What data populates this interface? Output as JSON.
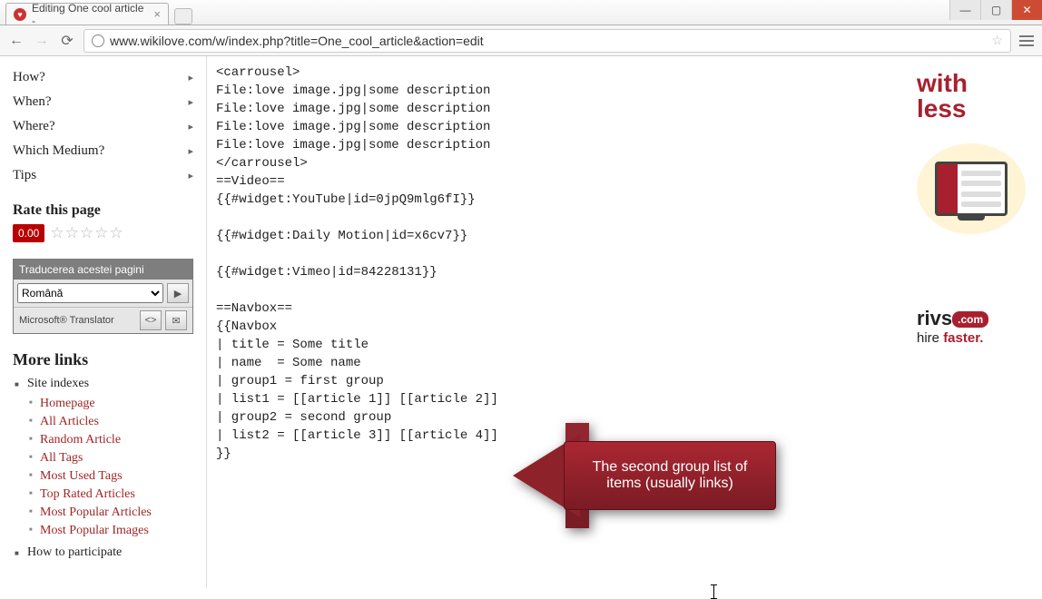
{
  "window": {
    "tab_title": "Editing One cool article - ",
    "url": "www.wikilove.com/w/index.php?title=One_cool_article&action=edit"
  },
  "sidebar": {
    "nav": [
      "How?",
      "When?",
      "Where?",
      "Which Medium?",
      "Tips"
    ],
    "rate_heading": "Rate this page",
    "rate_value": "0.00",
    "translate_heading": "Traducerea acestei pagini",
    "translate_lang": "Română",
    "translate_brand": "Microsoft® Translator",
    "more_heading": "More links",
    "site_indexes_label": "Site indexes",
    "site_indexes": [
      "Homepage",
      "All Articles",
      "Random Article",
      "All Tags",
      "Most Used Tags",
      "Top Rated Articles",
      "Most Popular Articles",
      "Most Popular Images"
    ],
    "how_to_label": "How to participate"
  },
  "editor": {
    "text": "<carrousel>\nFile:love image.jpg|some description\nFile:love image.jpg|some description\nFile:love image.jpg|some description\nFile:love image.jpg|some description\n</carrousel>\n==Video==\n{{#widget:YouTube|id=0jpQ9mlg6fI}}\n\n{{#widget:Daily Motion|id=x6cv7}}\n\n{{#widget:Vimeo|id=84228131}}\n\n==Navbox==\n{{Navbox\n| title = Some title\n| name  = Some name\n| group1 = first group\n| list1 = [[article 1]] [[article 2]]\n| group2 = second group\n| list2 = [[article 3]] [[article 4]]\n}}"
  },
  "callout": {
    "text": "The second group list of items (usually links)"
  },
  "ad": {
    "tagline1": "with",
    "tagline2": "less",
    "brand": "rivs",
    "brand_suffix": ".com",
    "slogan_prefix": "hire ",
    "slogan_bold": "faster.",
    "monitor_label": "rivs"
  }
}
